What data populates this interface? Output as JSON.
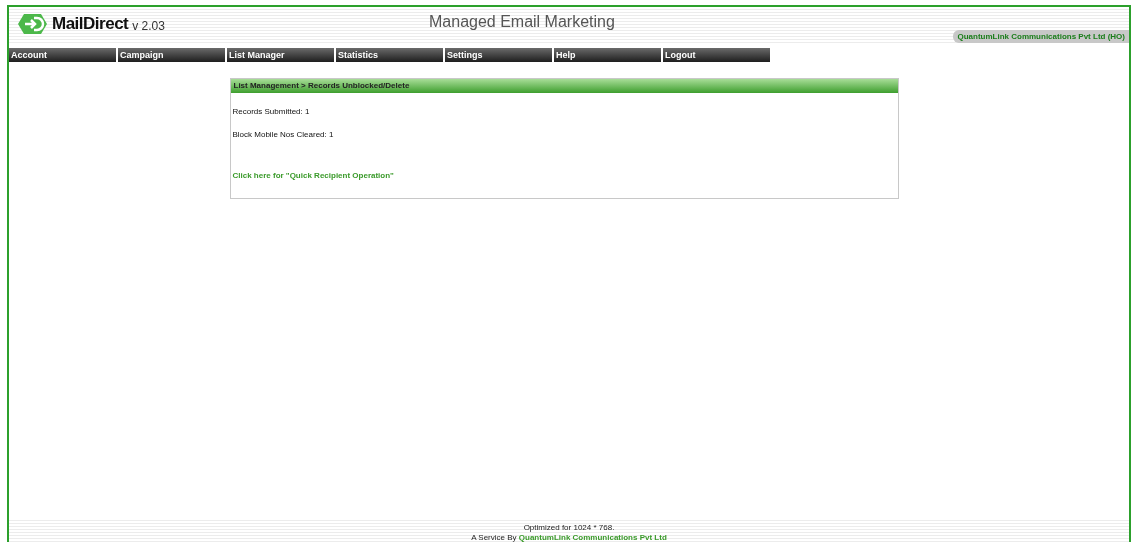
{
  "header": {
    "brand": "MailDirect",
    "version": "v 2.03",
    "title": "Managed Email Marketing",
    "company": "QuantumLink Communications Pvt Ltd (HO)"
  },
  "menu": [
    "Account",
    "Campaign",
    "List Manager",
    "Statistics",
    "Settings",
    "Help",
    "Logout"
  ],
  "panel": {
    "title": "List Management > Records Unblocked/Delete",
    "lines": [
      "Records Submitted: 1",
      "Block Mobile Nos Cleared: 1"
    ],
    "link": "Click here for \"Quick Recipient Operation\""
  },
  "footer": {
    "note": "Optimized for 1024 * 768.",
    "credit_prefix": "A Service By",
    "credit_link": "QuantumLink Communications Pvt Ltd"
  }
}
